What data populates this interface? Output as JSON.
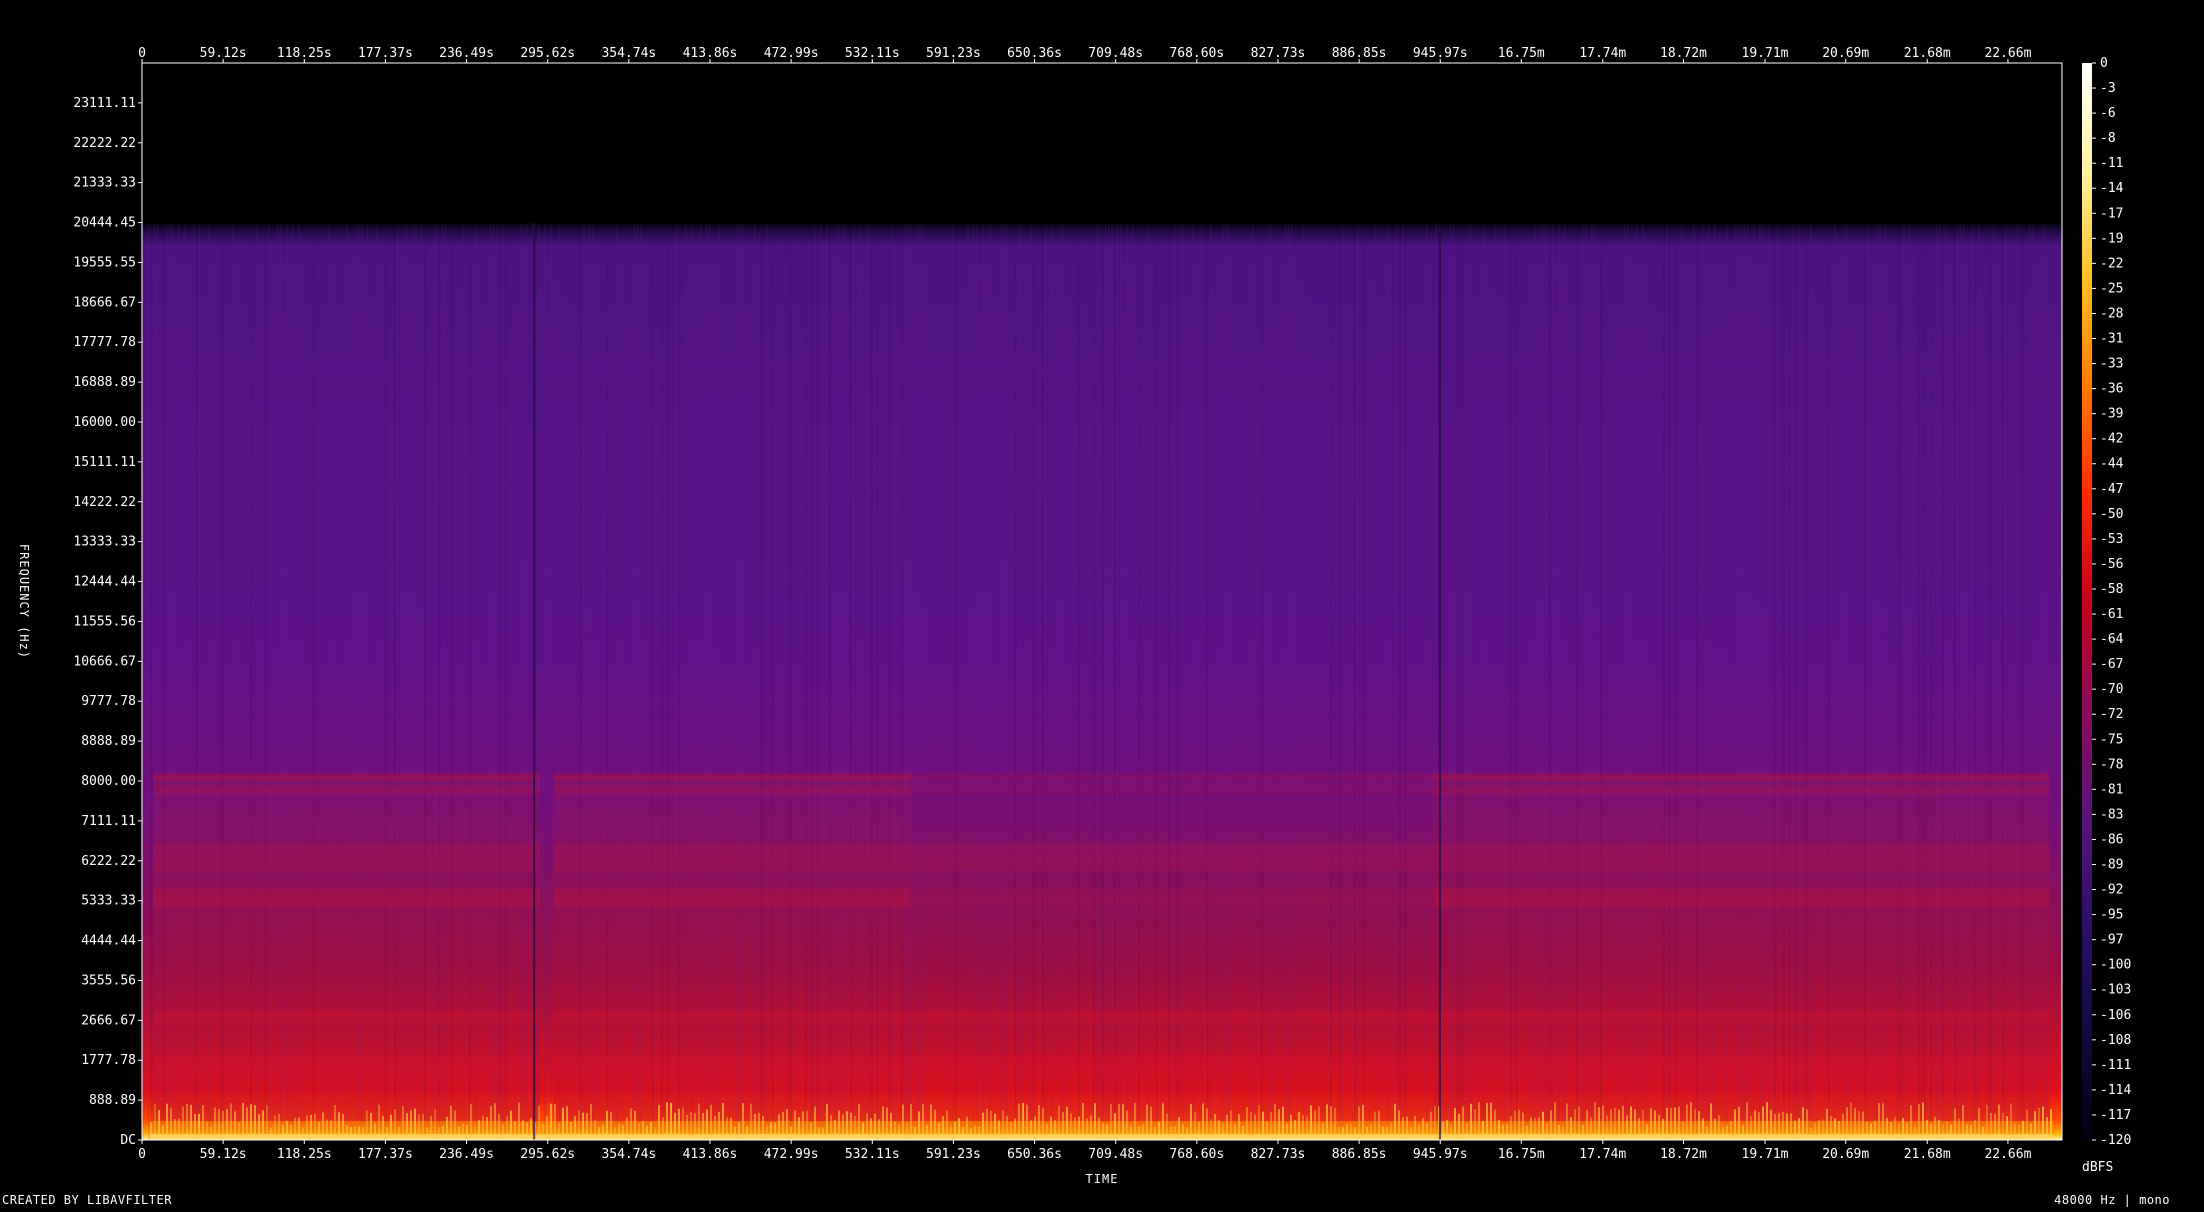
{
  "chart_data": {
    "type": "heatmap",
    "x_ticks": [
      "0",
      "59.12s",
      "118.25s",
      "177.37s",
      "236.49s",
      "295.62s",
      "354.74s",
      "413.86s",
      "472.99s",
      "532.11s",
      "591.23s",
      "650.36s",
      "709.48s",
      "768.60s",
      "827.73s",
      "886.85s",
      "945.97s",
      "16.75m",
      "17.74m",
      "18.72m",
      "19.71m",
      "20.69m",
      "21.68m",
      "22.66m"
    ],
    "x_tick_values_s": [
      0,
      59.12,
      118.25,
      177.37,
      236.49,
      295.62,
      354.74,
      413.86,
      472.99,
      532.11,
      591.23,
      650.36,
      709.48,
      768.6,
      827.73,
      886.85,
      945.97,
      1005.0,
      1064.4,
      1123.2,
      1182.6,
      1241.4,
      1300.8,
      1359.6
    ],
    "x_range_s": [
      0,
      1399
    ],
    "y_ticks": [
      "DC",
      "888.89",
      "1777.78",
      "2666.67",
      "3555.56",
      "4444.44",
      "5333.33",
      "6222.22",
      "7111.11",
      "8000.00",
      "8888.89",
      "9777.78",
      "10666.67",
      "11555.56",
      "12444.44",
      "13333.33",
      "14222.22",
      "15111.11",
      "16000.00",
      "16888.89",
      "17777.78",
      "18666.67",
      "19555.55",
      "20444.45",
      "21333.33",
      "22222.22",
      "23111.11"
    ],
    "y_tick_values_hz": [
      0,
      888.89,
      1777.78,
      2666.67,
      3555.56,
      4444.44,
      5333.33,
      6222.22,
      7111.11,
      8000,
      8888.89,
      9777.78,
      10666.67,
      11555.56,
      12444.44,
      13333.33,
      14222.22,
      15111.11,
      16000,
      16888.89,
      17777.78,
      18666.67,
      19555.55,
      20444.45,
      21333.33,
      22222.22,
      23111.11
    ],
    "y_range_hz": [
      0,
      24000
    ],
    "xlabel": "TIME",
    "ylabel": "FREQUENCY (Hz)",
    "colorbar_ticks": [
      "0",
      "-3",
      "-6",
      "-8",
      "-11",
      "-14",
      "-17",
      "-19",
      "-22",
      "-25",
      "-28",
      "-31",
      "-33",
      "-36",
      "-39",
      "-42",
      "-44",
      "-47",
      "-50",
      "-53",
      "-56",
      "-58",
      "-61",
      "-64",
      "-67",
      "-70",
      "-72",
      "-75",
      "-78",
      "-81",
      "-83",
      "-86",
      "-89",
      "-92",
      "-95",
      "-97",
      "-100",
      "-103",
      "-106",
      "-108",
      "-111",
      "-114",
      "-117",
      "-120"
    ],
    "colorbar_label": "dBFS",
    "colorbar_range_db": [
      -120,
      0
    ],
    "lowpass_cutoff_hz": 20444.45,
    "colorbar_stops": [
      "#ffffff",
      "#fff3a0",
      "#ffc020",
      "#ff7a00",
      "#ff2a00",
      "#c8001c",
      "#8a0a5a",
      "#5a137c",
      "#2c0f6a",
      "#0f0a40",
      "#000010"
    ],
    "footer_left": "CREATED BY LIBAVFILTER",
    "footer_right": "48000 Hz | mono"
  }
}
